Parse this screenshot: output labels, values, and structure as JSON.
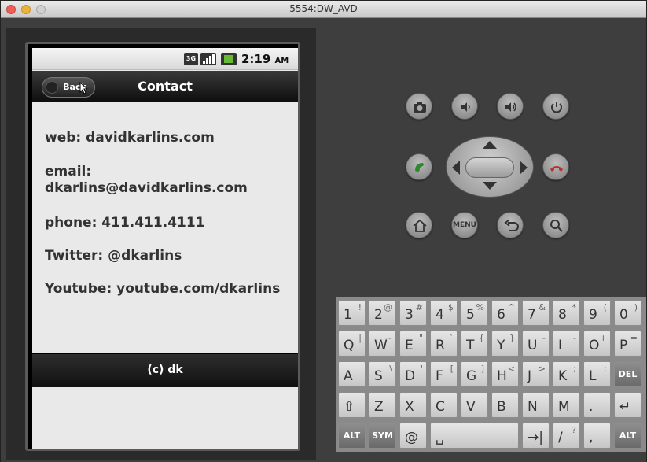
{
  "window": {
    "title": "5554:DW_AVD"
  },
  "status_bar": {
    "network": "3G",
    "time": "2:19",
    "ampm": "AM"
  },
  "header": {
    "back_label": "Back",
    "title": "Contact"
  },
  "content": {
    "web": "web: davidkarlins.com",
    "email_label": "email:",
    "email_value": "dkarlins@davidkarlins.com",
    "phone": "phone: 411.411.4111",
    "twitter": "Twitter: @dkarlins",
    "youtube": "Youtube: youtube.com/dkarlins"
  },
  "footer": {
    "text": "(c) dk"
  },
  "controls": {
    "menu_label": "MENU"
  },
  "keyboard": {
    "rows": [
      [
        {
          "m": "1",
          "a": "!"
        },
        {
          "m": "2",
          "a": "@"
        },
        {
          "m": "3",
          "a": "#"
        },
        {
          "m": "4",
          "a": "$"
        },
        {
          "m": "5",
          "a": "%"
        },
        {
          "m": "6",
          "a": "^"
        },
        {
          "m": "7",
          "a": "&"
        },
        {
          "m": "8",
          "a": "*"
        },
        {
          "m": "9",
          "a": "("
        },
        {
          "m": "0",
          "a": ")"
        }
      ],
      [
        {
          "m": "Q",
          "a": "|"
        },
        {
          "m": "W",
          "a": "~"
        },
        {
          "m": "E",
          "a": "\""
        },
        {
          "m": "R",
          "a": "`"
        },
        {
          "m": "T",
          "a": "{"
        },
        {
          "m": "Y",
          "a": "}"
        },
        {
          "m": "U",
          "a": "-"
        },
        {
          "m": "I",
          "a": "-"
        },
        {
          "m": "O",
          "a": "+"
        },
        {
          "m": "P",
          "a": "="
        }
      ],
      [
        {
          "m": "A",
          "a": ""
        },
        {
          "m": "S",
          "a": "\\"
        },
        {
          "m": "D",
          "a": "'"
        },
        {
          "m": "F",
          "a": "["
        },
        {
          "m": "G",
          "a": "]"
        },
        {
          "m": "H",
          "a": "<"
        },
        {
          "m": "J",
          "a": ">"
        },
        {
          "m": "K",
          "a": ";"
        },
        {
          "m": "L",
          "a": ":"
        },
        {
          "m": "DEL",
          "a": ""
        }
      ],
      [
        {
          "m": "⇧",
          "a": ""
        },
        {
          "m": "Z",
          "a": ""
        },
        {
          "m": "X",
          "a": ""
        },
        {
          "m": "C",
          "a": ""
        },
        {
          "m": "V",
          "a": ""
        },
        {
          "m": "B",
          "a": ""
        },
        {
          "m": "N",
          "a": ""
        },
        {
          "m": "M",
          "a": ""
        },
        {
          "m": ".",
          "a": ""
        },
        {
          "m": "↵",
          "a": ""
        }
      ],
      [
        {
          "m": "ALT",
          "a": ""
        },
        {
          "m": "SYM",
          "a": ""
        },
        {
          "m": "@",
          "a": ""
        },
        {
          "m": "␣",
          "a": ""
        },
        {
          "m": "→|",
          "a": ""
        },
        {
          "m": "/",
          "a": "?"
        },
        {
          "m": ",",
          "a": ""
        },
        {
          "m": "ALT",
          "a": ""
        }
      ]
    ]
  }
}
